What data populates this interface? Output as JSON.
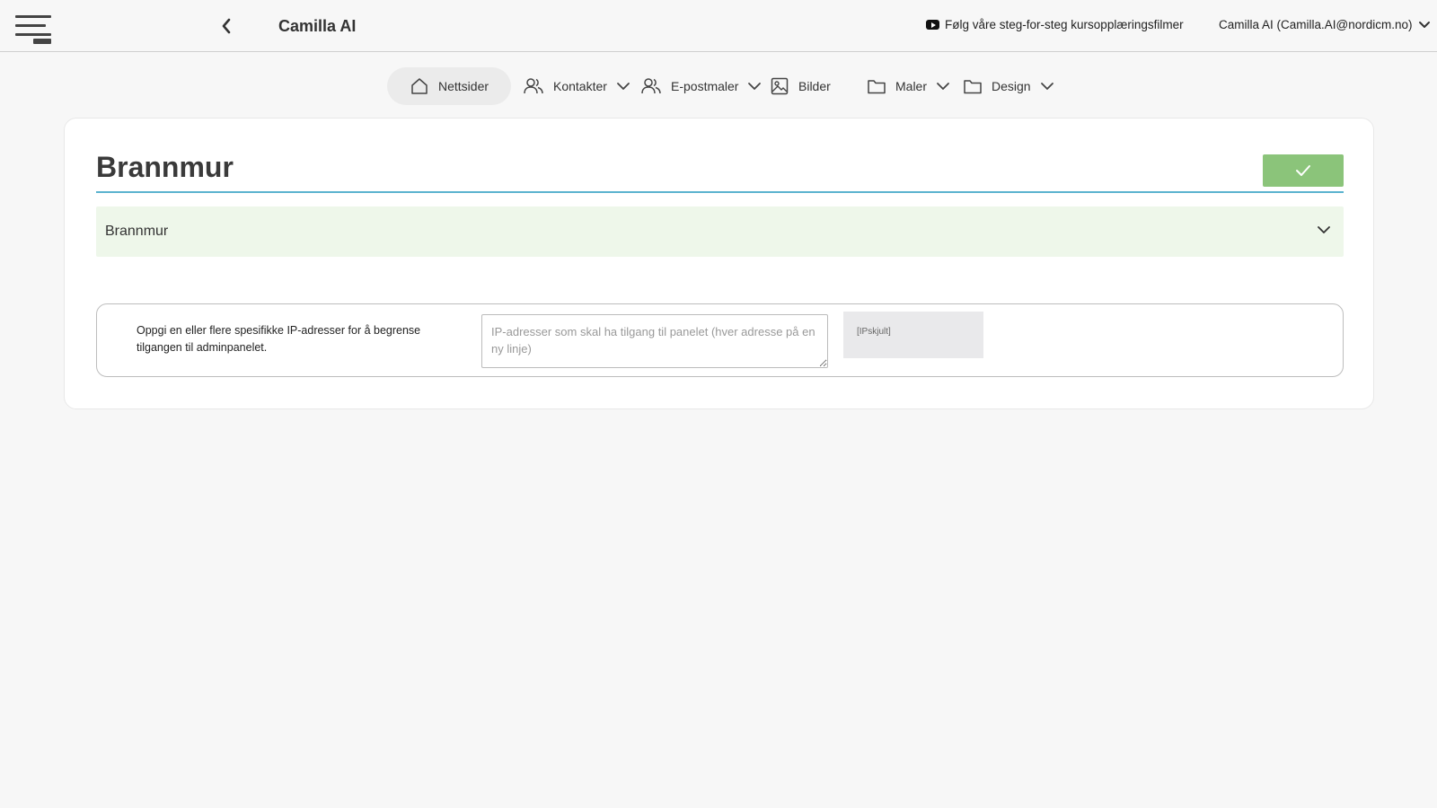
{
  "header": {
    "title": "Camilla AI",
    "tutorial_link": "Følg våre steg-for-steg kursopplæringsfilmer",
    "user": "Camilla AI (Camilla.AI@nordicm.no)"
  },
  "nav": {
    "items": [
      {
        "label": "Nettsider",
        "icon": "home-icon",
        "active": true
      },
      {
        "label": "Kontakter",
        "icon": "users-icon",
        "dropdown": true
      },
      {
        "label": "E-postmaler",
        "icon": "users-icon",
        "dropdown": true
      },
      {
        "label": "Bilder",
        "icon": "image-icon"
      },
      {
        "label": "Maler",
        "icon": "folder-icon",
        "dropdown": true
      },
      {
        "label": "Design",
        "icon": "folder-icon",
        "dropdown": true
      }
    ]
  },
  "page": {
    "heading": "Brannmur",
    "accordion_label": "Brannmur",
    "ip_label": "Oppgi en eller flere spesifikke IP-adresser for å begrense tilgangen til adminpanelet.",
    "ip_placeholder": "IP-adresser som skal ha tilgang til panelet (hver adresse på en ny linje)",
    "ip_value": "",
    "ip_hidden": "[IPskjult]"
  },
  "colors": {
    "accent_rule": "#5bb3cf",
    "confirm_button": "#8bc47a",
    "accordion_bg": "#eef7ea"
  }
}
